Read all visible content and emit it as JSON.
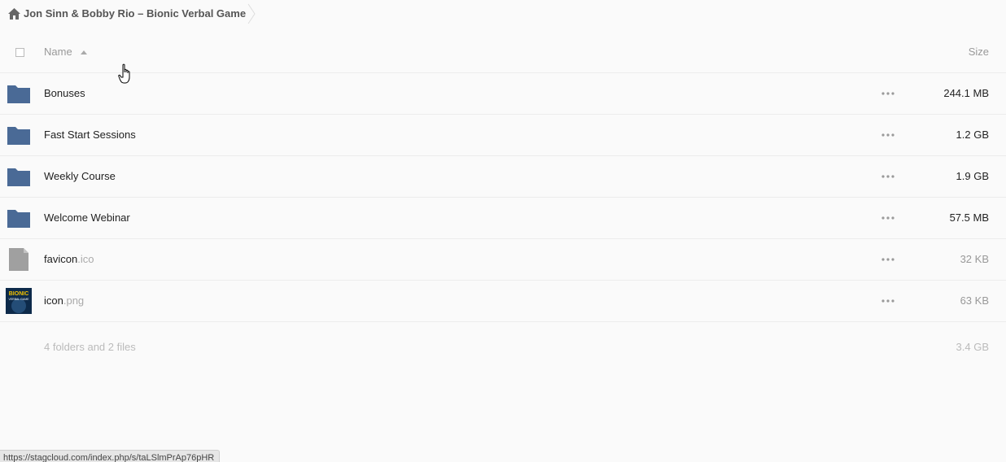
{
  "breadcrumb": {
    "home_icon": "home-icon",
    "title": "Jon Sinn & Bobby Rio – Bionic Verbal Game"
  },
  "header": {
    "name_label": "Name",
    "size_label": "Size",
    "sort_direction": "ascending"
  },
  "files": [
    {
      "name": "Bonuses",
      "ext": "",
      "type": "folder",
      "size": "244.1 MB"
    },
    {
      "name": "Fast Start Sessions",
      "ext": "",
      "type": "folder",
      "size": "1.2 GB"
    },
    {
      "name": "Weekly Course",
      "ext": "",
      "type": "folder",
      "size": "1.9 GB"
    },
    {
      "name": "Welcome Webinar",
      "ext": "",
      "type": "folder",
      "size": "57.5 MB"
    },
    {
      "name": "favicon",
      "ext": ".ico",
      "type": "file",
      "size": "32 KB"
    },
    {
      "name": "icon",
      "ext": ".png",
      "type": "image",
      "size": "63 KB"
    }
  ],
  "thumbnail": {
    "line1": "BIONIC",
    "line2": "VERBAL GAME"
  },
  "summary": {
    "text": "4 folders and 2 files",
    "total_size": "3.4 GB"
  },
  "status_bar": {
    "url": "https://stagcloud.com/index.php/s/taLSlmPrAp76pHR"
  },
  "colors": {
    "folder": "#4a6a96",
    "file_generic": "#a0a0a0",
    "background": "#fafafa"
  }
}
